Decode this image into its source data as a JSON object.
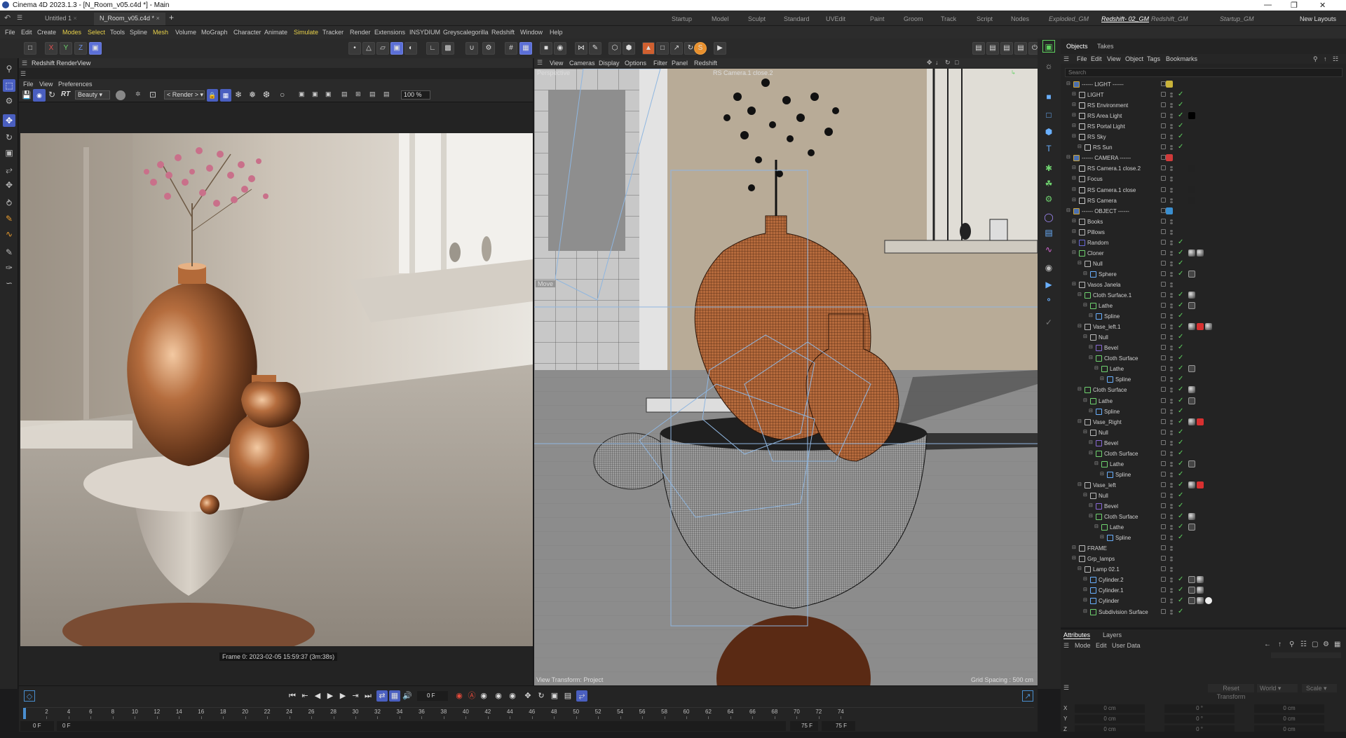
{
  "title_bar": {
    "text": "Cinema 4D 2023.1.3 - [N_Room_v05.c4d *] - Main"
  },
  "doc_tabs": [
    {
      "label": "Untitled 1",
      "active": false
    },
    {
      "label": "N_Room_v05.c4d *",
      "active": true
    }
  ],
  "layouts": [
    "Startup",
    "Model",
    "Sculpt",
    "Standard",
    "UVEdit",
    "Paint",
    "Groom",
    "Track",
    "Script",
    "Nodes",
    "Exploded_GM",
    "Redshift- 02_GM",
    "Redshift_GM",
    "Startup_GM"
  ],
  "active_layout": "Redshift- 02_GM",
  "new_layouts": "New Layouts",
  "menu": [
    "File",
    "Edit",
    "Create",
    "Modes",
    "Select",
    "Tools",
    "Spline",
    "Mesh",
    "Volume",
    "MoGraph",
    "Character",
    "Animate",
    "Simulate",
    "Tracker",
    "Render",
    "Extensions",
    "INSYDIUM",
    "Greyscalegorilla",
    "Redshift",
    "Window",
    "Help"
  ],
  "toolbar": {
    "axis_x": "X",
    "axis_y": "Y",
    "axis_z": "Z"
  },
  "render_view": {
    "title": "Redshift RenderView",
    "menu": [
      "File",
      "View",
      "Preferences"
    ],
    "rt_label": "RT",
    "aov": "Beauty",
    "render_mode": "< Render >",
    "zoom": "100 %",
    "frame_info": "Frame  0:  2023-02-05  15:59:37  (3m:38s)"
  },
  "viewport": {
    "menu": [
      "View",
      "Cameras",
      "Display",
      "Options",
      "Filter",
      "Panel",
      "Redshift"
    ],
    "label": "Perspective",
    "camera_label": "RS Camera.1 close.2",
    "move_label": "Move",
    "view_transform": "View Transform: Project",
    "grid_spacing": "Grid Spacing : 500 cm"
  },
  "objects": {
    "tabs": [
      "Objects",
      "Takes"
    ],
    "menu": [
      "File",
      "Edit",
      "View",
      "Object",
      "Tags",
      "Bookmarks"
    ],
    "search_placeholder": "Search",
    "rows": [
      {
        "name": "------ LIGHT ------",
        "depth": 0,
        "icon": "folder",
        "color": "#c9b33a",
        "tick": false
      },
      {
        "name": "LIGHT",
        "depth": 1,
        "icon": "null",
        "tick": true
      },
      {
        "name": "RS Environment",
        "depth": 1,
        "icon": "light",
        "tick": true
      },
      {
        "name": "RS Area Light",
        "depth": 1,
        "icon": "light",
        "tick": true,
        "tags": [
          "black"
        ]
      },
      {
        "name": "RS Portal Light",
        "depth": 1,
        "icon": "light",
        "tick": true
      },
      {
        "name": "RS Sky",
        "depth": 1,
        "icon": "light",
        "tick": true
      },
      {
        "name": "RS Sun",
        "depth": 2,
        "icon": "light",
        "tick": true
      },
      {
        "name": "------ CAMERA ------",
        "depth": 0,
        "icon": "folder",
        "color": "#d03a3a",
        "tick": false
      },
      {
        "name": "RS Camera.1 close.2",
        "depth": 1,
        "icon": "camera",
        "tick": false,
        "tags": [
          "cam"
        ]
      },
      {
        "name": "Focus",
        "depth": 1,
        "icon": "null",
        "tick": false
      },
      {
        "name": "RS Camera.1 close",
        "depth": 1,
        "icon": "camera",
        "tick": false,
        "tags": [
          "cam"
        ]
      },
      {
        "name": "RS Camera",
        "depth": 1,
        "icon": "camera",
        "tick": false,
        "tags": [
          "cam"
        ]
      },
      {
        "name": "------ OBJECT ------",
        "depth": 0,
        "icon": "folder",
        "color": "#3a8fd0",
        "tick": false
      },
      {
        "name": "Books",
        "depth": 1,
        "icon": "null",
        "tick": false
      },
      {
        "name": "Pillows",
        "depth": 1,
        "icon": "null",
        "tick": false
      },
      {
        "name": "Random",
        "depth": 1,
        "icon": "effector",
        "tick": true
      },
      {
        "name": "Cloner",
        "depth": 1,
        "icon": "cloner",
        "tick": true,
        "tags": [
          "mat",
          "mat"
        ]
      },
      {
        "name": "Null",
        "depth": 2,
        "icon": "null",
        "tick": true
      },
      {
        "name": "Sphere",
        "depth": 3,
        "icon": "sphere",
        "tick": true,
        "tags": [
          "phong"
        ]
      },
      {
        "name": "Vasos Janela",
        "depth": 1,
        "icon": "null",
        "tick": false
      },
      {
        "name": "Cloth Surface.1",
        "depth": 2,
        "icon": "cloth",
        "tick": true,
        "tags": [
          "mat"
        ]
      },
      {
        "name": "Lathe",
        "depth": 3,
        "icon": "lathe",
        "tick": true,
        "tags": [
          "phong"
        ]
      },
      {
        "name": "Spline",
        "depth": 4,
        "icon": "spline",
        "tick": true
      },
      {
        "name": "Vase_left.1",
        "depth": 2,
        "icon": "null",
        "tick": true,
        "tags": [
          "mat",
          "red",
          "mat"
        ]
      },
      {
        "name": "Null",
        "depth": 3,
        "icon": "null",
        "tick": true
      },
      {
        "name": "Bevel",
        "depth": 4,
        "icon": "deformer",
        "tick": true
      },
      {
        "name": "Cloth Surface",
        "depth": 4,
        "icon": "cloth",
        "tick": true
      },
      {
        "name": "Lathe",
        "depth": 5,
        "icon": "lathe",
        "tick": true,
        "tags": [
          "phong"
        ]
      },
      {
        "name": "Spline",
        "depth": 6,
        "icon": "spline",
        "tick": true
      },
      {
        "name": "Cloth Surface",
        "depth": 2,
        "icon": "cloth",
        "tick": true,
        "tags": [
          "mat"
        ]
      },
      {
        "name": "Lathe",
        "depth": 3,
        "icon": "lathe",
        "tick": true,
        "tags": [
          "phong"
        ]
      },
      {
        "name": "Spline",
        "depth": 4,
        "icon": "spline",
        "tick": true
      },
      {
        "name": "Vase_Right",
        "depth": 2,
        "icon": "null",
        "tick": true,
        "tags": [
          "mat",
          "red"
        ]
      },
      {
        "name": "Null",
        "depth": 3,
        "icon": "null",
        "tick": true
      },
      {
        "name": "Bevel",
        "depth": 4,
        "icon": "deformer",
        "tick": true
      },
      {
        "name": "Cloth Surface",
        "depth": 4,
        "icon": "cloth",
        "tick": true
      },
      {
        "name": "Lathe",
        "depth": 5,
        "icon": "lathe",
        "tick": true,
        "tags": [
          "phong"
        ]
      },
      {
        "name": "Spline",
        "depth": 6,
        "icon": "spline",
        "tick": true
      },
      {
        "name": "Vase_left",
        "depth": 2,
        "icon": "null",
        "tick": true,
        "tags": [
          "mat",
          "red"
        ]
      },
      {
        "name": "Null",
        "depth": 3,
        "icon": "null",
        "tick": true
      },
      {
        "name": "Bevel",
        "depth": 4,
        "icon": "deformer",
        "tick": true
      },
      {
        "name": "Cloth Surface",
        "depth": 4,
        "icon": "cloth",
        "tick": true,
        "tags": [
          "mat"
        ]
      },
      {
        "name": "Lathe",
        "depth": 5,
        "icon": "lathe",
        "tick": true,
        "tags": [
          "phong"
        ]
      },
      {
        "name": "Spline",
        "depth": 6,
        "icon": "spline",
        "tick": true
      },
      {
        "name": "FRAME",
        "depth": 1,
        "icon": "null",
        "tick": false
      },
      {
        "name": "Grp_lamps",
        "depth": 1,
        "icon": "null",
        "tick": false
      },
      {
        "name": "Lamp 02.1",
        "depth": 2,
        "icon": "null",
        "tick": false
      },
      {
        "name": "Cylinder.2",
        "depth": 3,
        "icon": "cylinder",
        "tick": true,
        "tags": [
          "phong",
          "mat"
        ]
      },
      {
        "name": "Cylinder.1",
        "depth": 3,
        "icon": "cylinder",
        "tick": true,
        "tags": [
          "phong",
          "mat"
        ]
      },
      {
        "name": "Cylinder",
        "depth": 3,
        "icon": "cylinder",
        "tick": true,
        "tags": [
          "phong",
          "mat",
          "white"
        ]
      },
      {
        "name": "Subdivision Surface",
        "depth": 3,
        "icon": "subdiv",
        "tick": true
      }
    ]
  },
  "attributes": {
    "tabs": [
      "Attributes",
      "Layers"
    ],
    "menu": [
      "Mode",
      "Edit",
      "User Data"
    ],
    "reset_transform": "Reset Transform",
    "space": "World",
    "scale_label": "Scale",
    "coords": [
      {
        "axis": "X",
        "pos": "0 cm",
        "rot": "0 °",
        "size": "0 cm"
      },
      {
        "axis": "Y",
        "pos": "0 cm",
        "rot": "0 °",
        "size": "0 cm"
      },
      {
        "axis": "Z",
        "pos": "0 cm",
        "rot": "0 °",
        "size": "0 cm"
      }
    ]
  },
  "timeline": {
    "current_frame": "0 F",
    "start": "0 F",
    "start2": "0 F",
    "end": "75 F",
    "end2": "75 F",
    "ticks": [
      0,
      2,
      4,
      6,
      8,
      10,
      12,
      14,
      16,
      18,
      20,
      22,
      24,
      26,
      28,
      30,
      32,
      34,
      36,
      38,
      40,
      42,
      44,
      46,
      48,
      50,
      52,
      54,
      56,
      58,
      60,
      62,
      64,
      66,
      68,
      70,
      72,
      74
    ],
    "max_frame": 75
  },
  "colors": {
    "accent": "#4a5fc0",
    "highlight": "#e8d14a",
    "check": "#5fd35f"
  }
}
